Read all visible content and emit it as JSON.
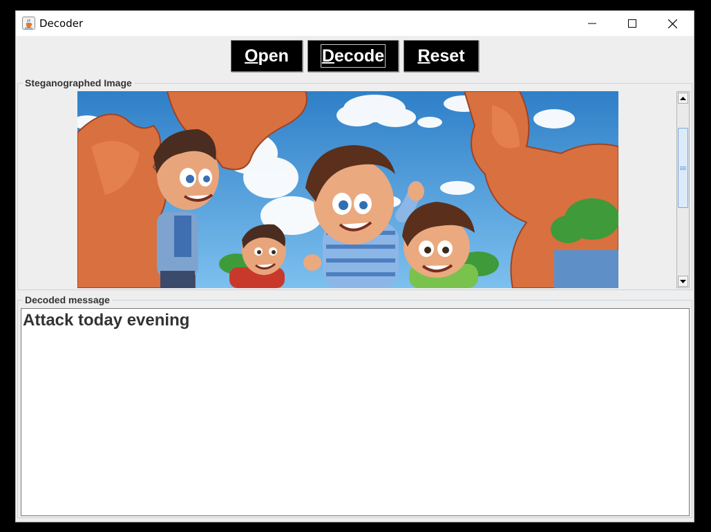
{
  "window": {
    "title": "Decoder",
    "icon": "java-cup-icon",
    "controls": [
      "minimize-icon",
      "maximize-icon",
      "close-icon"
    ]
  },
  "toolbar": {
    "open": {
      "mnemonic": "O",
      "rest": "pen"
    },
    "decode": {
      "mnemonic": "D",
      "rest": "ecode"
    },
    "reset": {
      "mnemonic": "R",
      "rest": "eset"
    }
  },
  "image_panel": {
    "title": "Steganographed Image",
    "image_icon": "cartoon-boys-canyon-illustration"
  },
  "message_panel": {
    "title": "Decoded message",
    "text": "Attack today evening"
  },
  "colors": {
    "button_bg": "#000000",
    "button_text": "#ffffff",
    "window_bg": "#eeeeee",
    "scroll_thumb": "#dcebfa"
  }
}
